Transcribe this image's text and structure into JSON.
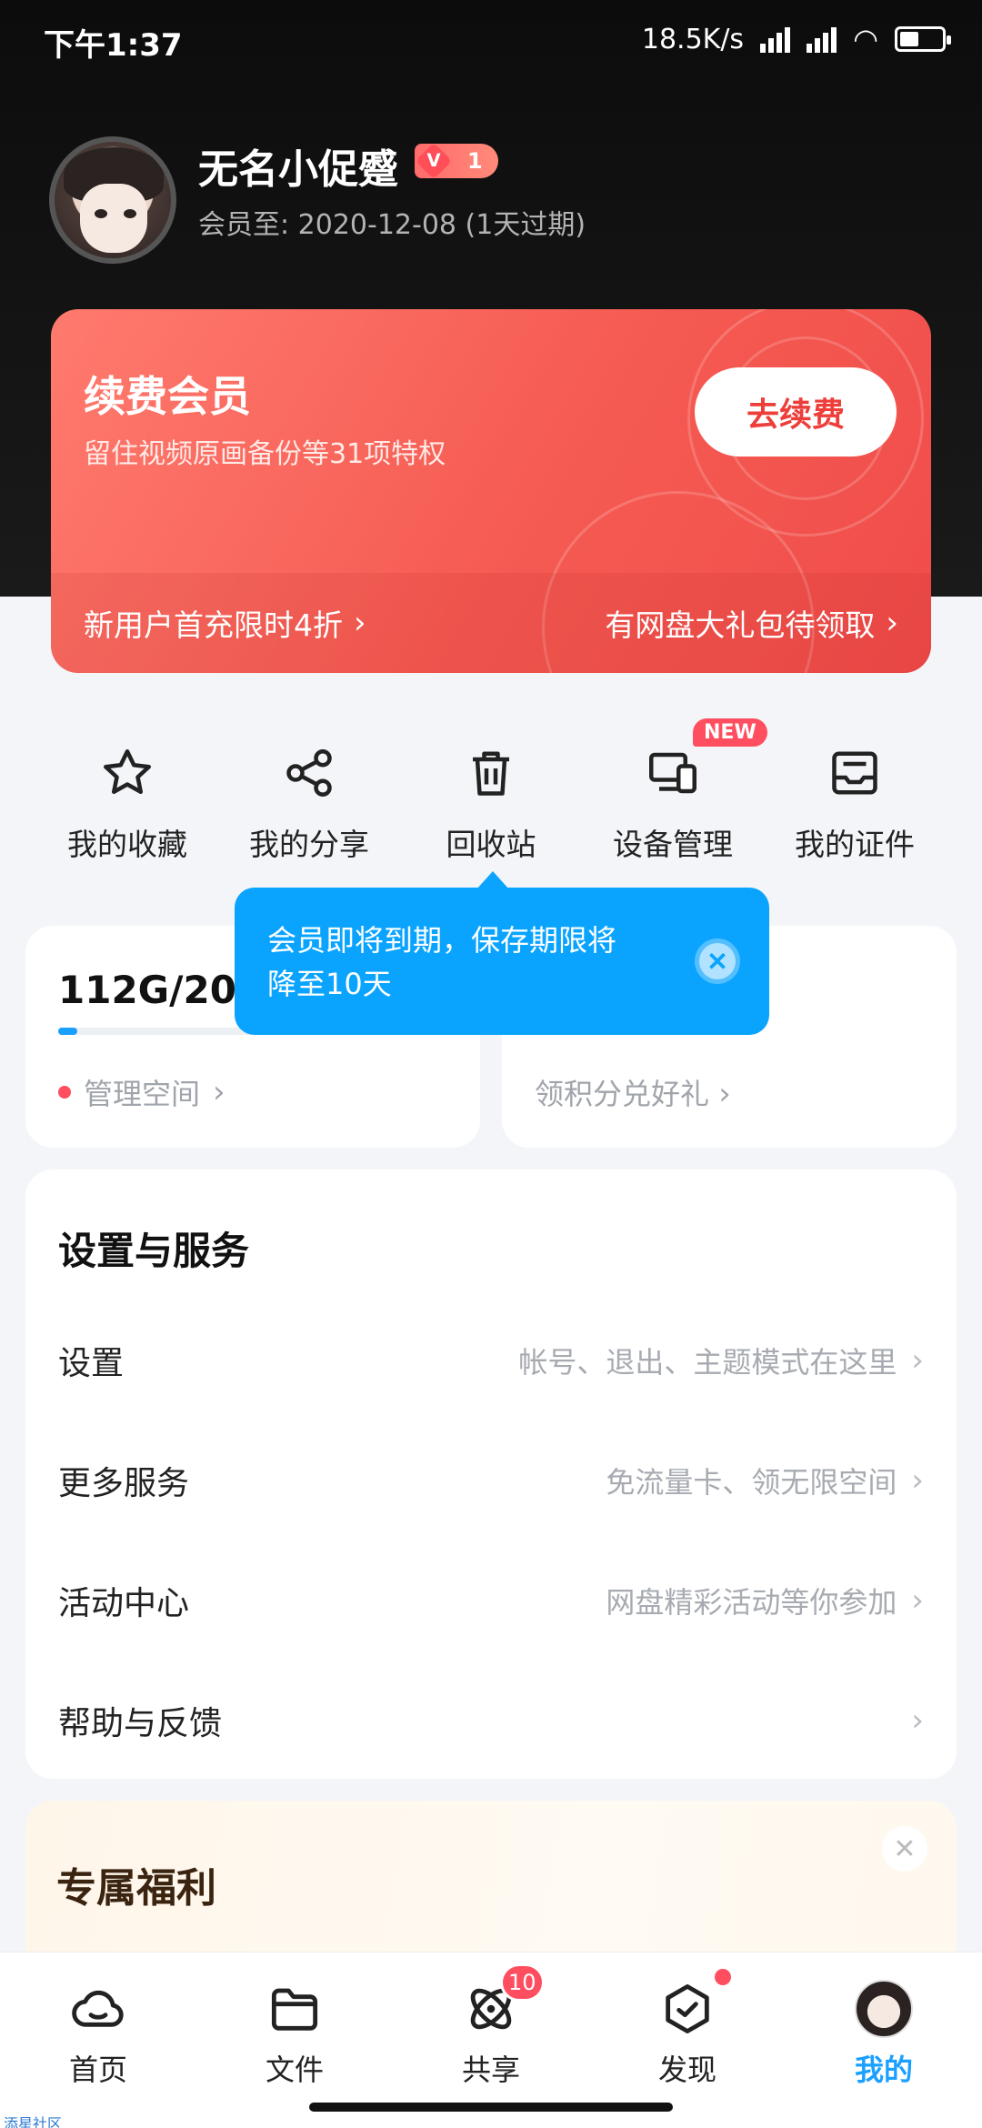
{
  "status_bar": {
    "time": "下午1:37",
    "speed": "18.5K/s"
  },
  "profile": {
    "username": "无名小促蹙",
    "vip_level": "1",
    "member_until": "会员至: 2020-12-08 (1天过期)"
  },
  "renew": {
    "title": "续费会员",
    "subtitle": "留住视频原画备份等31项特权",
    "button": "去续费",
    "left_link": "新用户首充限时4折",
    "right_link": "有网盘大礼包待领取"
  },
  "quick_actions": [
    {
      "label": "我的收藏",
      "icon": "star-icon"
    },
    {
      "label": "我的分享",
      "icon": "share-icon"
    },
    {
      "label": "回收站",
      "icon": "trash-icon"
    },
    {
      "label": "设备管理",
      "icon": "devices-icon",
      "badge": "NEW"
    },
    {
      "label": "我的证件",
      "icon": "id-card-icon"
    }
  ],
  "storage": {
    "text": "112G/206",
    "manage_label": "管理空间",
    "used_fraction": 0.05
  },
  "points": {
    "link_label": "领积分兑好礼"
  },
  "tooltip": {
    "line1": "会员即将到期，保存期限将",
    "line2": "降至10天",
    "close": "✕"
  },
  "settings": {
    "title": "设置与服务",
    "rows": [
      {
        "label": "设置",
        "hint": "帐号、退出、主题模式在这里"
      },
      {
        "label": "更多服务",
        "hint": "免流量卡、领无限空间"
      },
      {
        "label": "活动中心",
        "hint": "网盘精彩活动等你参加"
      },
      {
        "label": "帮助与反馈",
        "hint": ""
      }
    ]
  },
  "benefits": {
    "title": "专属福利",
    "close": "✕"
  },
  "tabs": [
    {
      "label": "首页",
      "icon": "cloud-icon"
    },
    {
      "label": "文件",
      "icon": "folder-icon"
    },
    {
      "label": "共享",
      "icon": "share-orbit-icon",
      "badge": "10"
    },
    {
      "label": "发现",
      "icon": "discover-icon",
      "dot": true
    },
    {
      "label": "我的",
      "icon": "avatar-icon",
      "active": true
    }
  ],
  "chevron": "›",
  "watermark": "添星社区",
  "colors": {
    "accent": "#1aa0ff",
    "renew_red": "#f55b52",
    "badge_red": "#ff4e60",
    "tooltip_blue": "#0aa4ff"
  }
}
